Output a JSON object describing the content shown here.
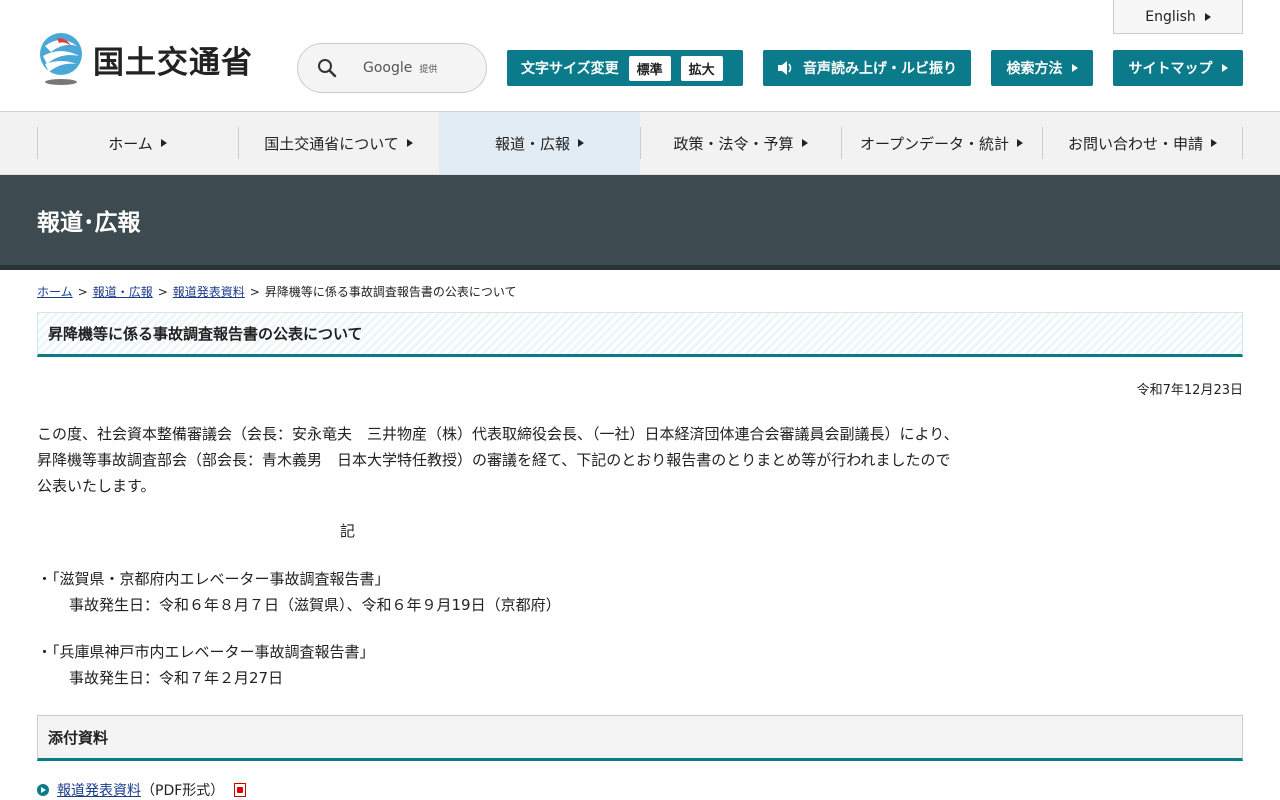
{
  "header": {
    "logo_text": "国土交通省",
    "english_label": "English",
    "search": {
      "engine": "Google",
      "provided": "提供"
    },
    "fontsize": {
      "label": "文字サイズ変更",
      "standard": "標準",
      "large": "拡大"
    },
    "voice_label": "音声読み上げ・ルビ振り",
    "search_method_label": "検索方法",
    "sitemap_label": "サイトマップ"
  },
  "gnav": {
    "items": [
      {
        "label": "ホーム"
      },
      {
        "label": "国土交通省について"
      },
      {
        "label": "報道・広報"
      },
      {
        "label": "政策・法令・予算"
      },
      {
        "label": "オープンデータ・統計"
      },
      {
        "label": "お問い合わせ・申請"
      }
    ]
  },
  "banner": {
    "title": "報道･広報"
  },
  "breadcrumb": {
    "home": "ホーム",
    "press": "報道・広報",
    "releases": "報道発表資料",
    "current": "昇降機等に係る事故調査報告書の公表について",
    "sep": ">"
  },
  "page": {
    "title": "昇降機等に係る事故調査報告書の公表について",
    "date": "令和7年12月23日",
    "body_lines": [
      "この度、社会資本整備審議会（会長：安永竜夫　三井物産（株）代表取締役会長、（一社）日本経済団体連合会審議員会副議長）により、",
      "昇降機等事故調査部会（部会長：青木義男　日本大学特任教授）の審議を経て、下記のとおり報告書のとりまとめ等が行われましたので",
      "公表いたします。"
    ],
    "ki": "記",
    "items": [
      {
        "title": "・「滋賀県・京都府内エレベーター事故調査報告書」",
        "detail": "事故発生日：令和６年８月７日（滋賀県）、令和６年９月19日（京都府）"
      },
      {
        "title": "・「兵庫県神戸市内エレベーター事故調査報告書」",
        "detail": "事故発生日：令和７年２月27日"
      }
    ]
  },
  "attachments": {
    "title": "添付資料",
    "link_label": "報道発表資料",
    "link_format": "（PDF形式）"
  },
  "colors": {
    "teal": "#0b7a8a",
    "banner": "#3d4a4f",
    "nav_active": "#e1ecf4"
  }
}
